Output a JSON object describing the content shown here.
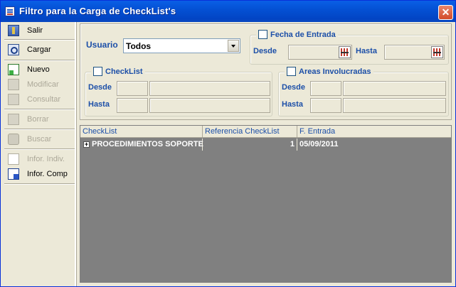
{
  "window": {
    "title": "Filtro para la Carga de CheckList's"
  },
  "sidebar": {
    "items": [
      {
        "label": "Salir",
        "enabled": true,
        "icon": "exit-door-icon"
      },
      {
        "label": "Cargar",
        "enabled": true,
        "icon": "magnifier-load-icon"
      },
      {
        "label": "Nuevo",
        "enabled": true,
        "icon": "new-record-icon"
      },
      {
        "label": "Modificar",
        "enabled": false,
        "icon": "edit-icon"
      },
      {
        "label": "Consultar",
        "enabled": false,
        "icon": "eye-icon"
      },
      {
        "label": "Borrar",
        "enabled": false,
        "icon": "eraser-icon"
      },
      {
        "label": "Buscar",
        "enabled": false,
        "icon": "binoculars-icon"
      },
      {
        "label": "Infor. Indiv.",
        "enabled": false,
        "icon": "report-icon"
      },
      {
        "label": "Infor. Comp",
        "enabled": true,
        "icon": "report-composite-icon"
      }
    ]
  },
  "filters": {
    "usuario_label": "Usuario",
    "usuario_value": "Todos",
    "fecha_entrada": {
      "title": "Fecha de Entrada",
      "desde_label": "Desde",
      "hasta_label": "Hasta",
      "desde_value": "",
      "hasta_value": ""
    },
    "checklist": {
      "title": "CheckList",
      "desde_label": "Desde",
      "hasta_label": "Hasta"
    },
    "areas": {
      "title": "Areas Involucradas",
      "desde_label": "Desde",
      "hasta_label": "Hasta"
    }
  },
  "grid": {
    "columns": [
      "CheckList",
      "Referencia CheckList",
      "F. Entrada"
    ],
    "rows": [
      {
        "checklist": "PROCEDIMIENTOS SOPORTE",
        "referencia": "1",
        "fecha": "05/09/2011"
      }
    ]
  }
}
